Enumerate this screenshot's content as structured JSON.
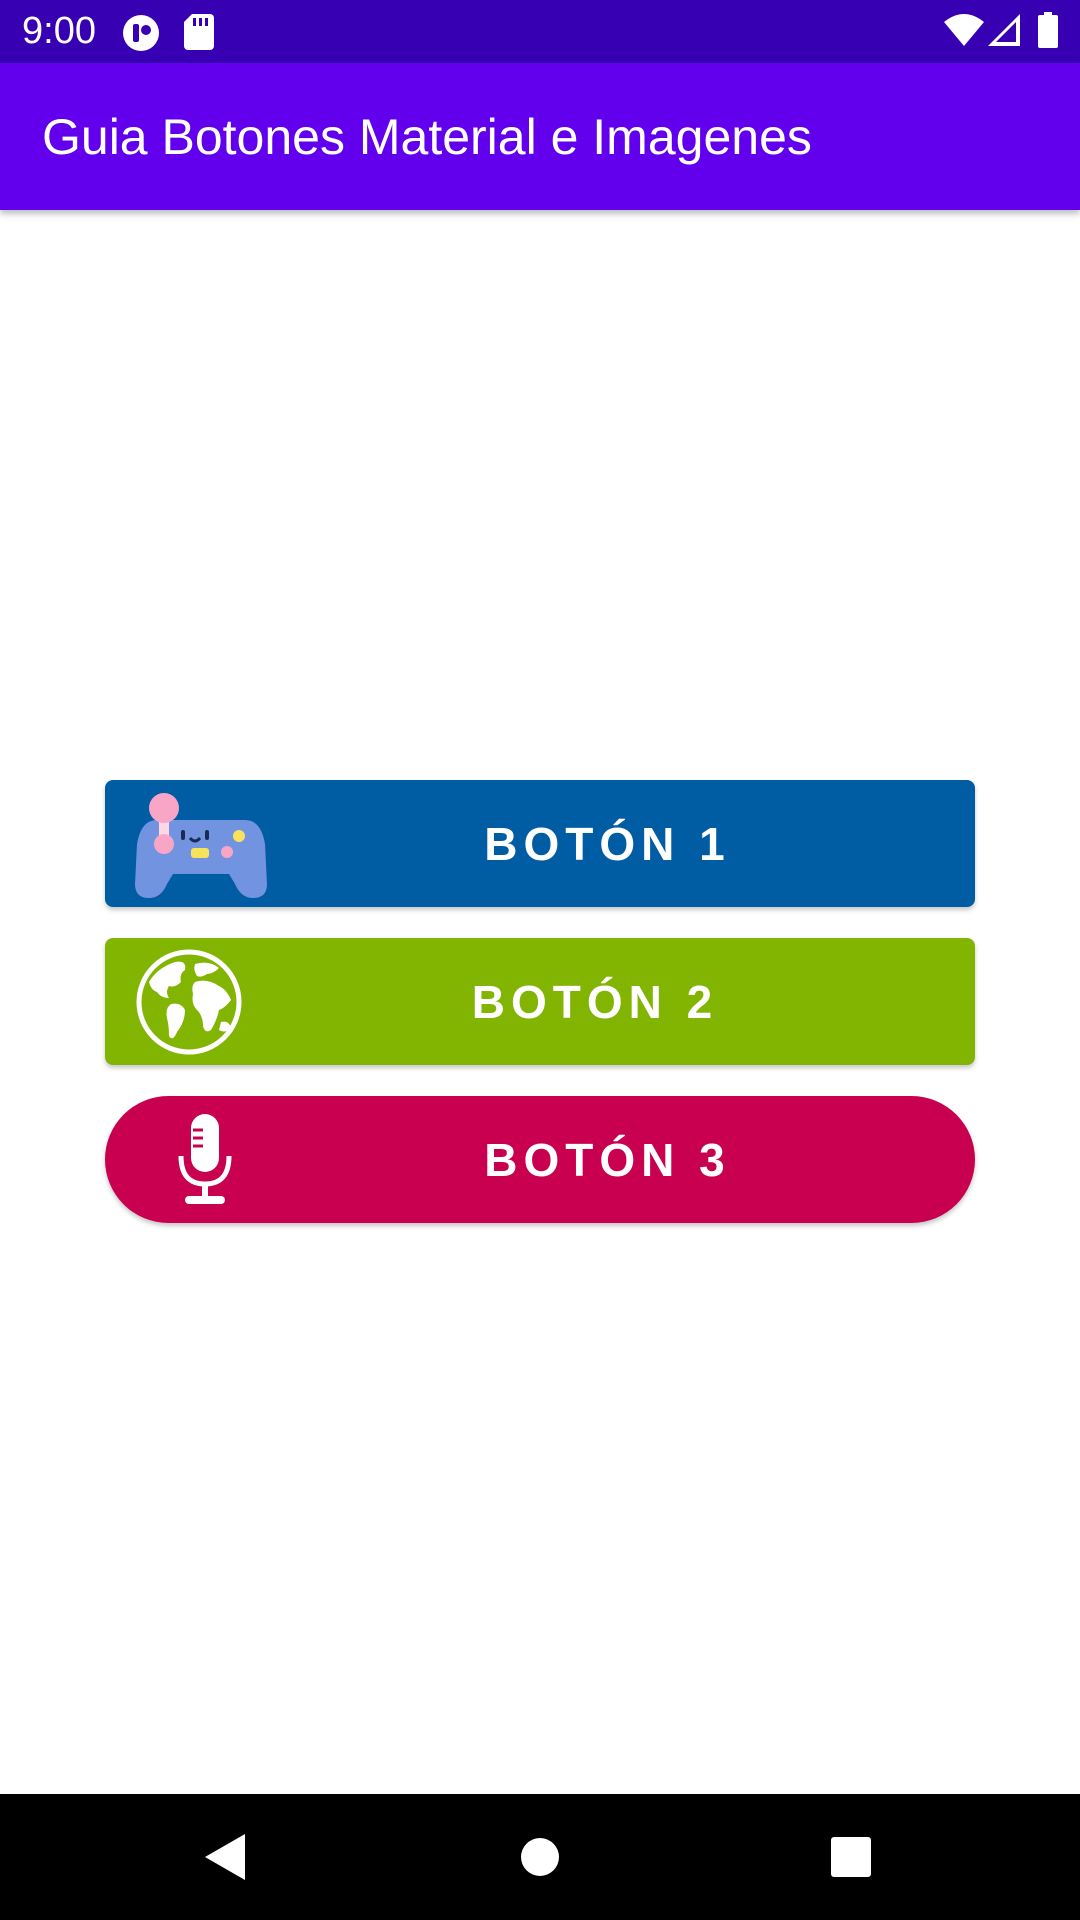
{
  "status_bar": {
    "time": "9:00",
    "icons": [
      "app-notification-icon",
      "sd-card-icon",
      "wifi-icon",
      "signal-icon",
      "battery-icon"
    ],
    "background": "#3700B3"
  },
  "app_bar": {
    "title": "Guia Botones Material e Imagenes",
    "background": "#6200EE"
  },
  "buttons": [
    {
      "label": "BOTÓN 1",
      "icon": "gamepad-icon",
      "color": "#005CA3"
    },
    {
      "label": "BOTÓN 2",
      "icon": "globe-icon",
      "color": "#82B501"
    },
    {
      "label": "BOTÓN 3",
      "icon": "microphone-icon",
      "color": "#C8004F"
    }
  ],
  "nav_bar": {
    "items": [
      "back-icon",
      "home-icon",
      "recents-icon"
    ]
  }
}
